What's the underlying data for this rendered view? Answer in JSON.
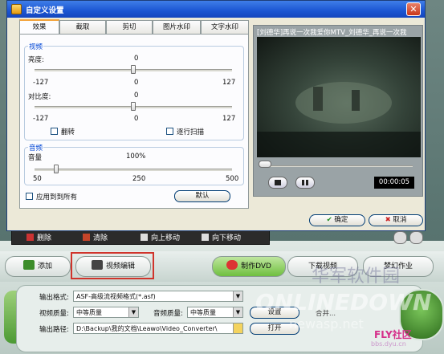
{
  "dialog": {
    "title": "自定义设置",
    "close": "✕",
    "tabs": [
      "效果",
      "截取",
      "剪切",
      "图片水印",
      "文字水印"
    ],
    "video_group": {
      "title": "视频",
      "brightness": {
        "label": "亮度:",
        "value": "0",
        "min": "-127",
        "mid": "0",
        "max": "127",
        "level": 0.5
      },
      "contrast": {
        "label": "对比度:",
        "value": "0",
        "min": "-127",
        "mid": "0",
        "max": "127",
        "level": 0.5
      },
      "flip_label": "翻转",
      "progressive_label": "逐行扫描"
    },
    "audio_group": {
      "title": "音频",
      "volume": {
        "label": "音量",
        "value": "100%",
        "min": "50",
        "mid": "250",
        "max": "500",
        "level": 0.11
      }
    },
    "apply_all_label": "应用到到所有",
    "default_button": "默认",
    "preview": {
      "title": "[刘德华]再说一次我爱你MTV_刘德华_再说一次我",
      "time": "00:00:05",
      "seek_level": 0.03
    },
    "ok_button": "确定",
    "cancel_button": "取消"
  },
  "strip": {
    "delete": "删除",
    "clear": "清除",
    "move_up": "向上移动",
    "move_down": "向下移动"
  },
  "actions": {
    "add": "添加",
    "video_edit": "视频编辑",
    "make_dvd": "制作DVD",
    "download_video": "下载视频",
    "dream_work": "梦幻作业"
  },
  "output": {
    "format_label": "输出格式:",
    "format_value": "ASF-高级流视频格式(*.asf)",
    "video_quality_label": "视频质量:",
    "video_quality_value": "中等质量",
    "audio_quality_label": "音频质量:",
    "audio_quality_value": "中等质量",
    "path_label": "输出路径:",
    "path_value": "D:\\Backup\\我的文档\\Leawo\\Video_Converter\\",
    "settings_button": "设置",
    "open_button": "打开",
    "merge_label": "合并..."
  },
  "watermark": {
    "cn": "华军软件园",
    "en": "ONLINEDOWN",
    "net": "newasp.net",
    "fly": "FLY社区",
    "url": "bbs.dyu.cn"
  }
}
